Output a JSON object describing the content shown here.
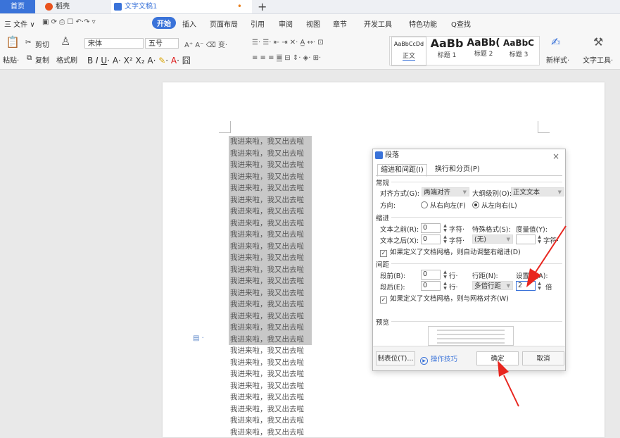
{
  "tabbar": {
    "home": "首页",
    "daoke": "稻壳",
    "doc": "文字文稿1",
    "modified_dot": "•",
    "plus": "+"
  },
  "menubar": {
    "file": "三 文件 ∨",
    "items": [
      "开始",
      "插入",
      "页面布局",
      "引用",
      "审阅",
      "视图",
      "章节",
      "开发工具",
      "特色功能"
    ],
    "search": "Q查找"
  },
  "ribbon": {
    "paste": "粘贴·",
    "cut": "剪切",
    "copy": "复制",
    "format_painter": "格式刷",
    "font_name": "宋体",
    "font_size": "五号",
    "styles": [
      {
        "sample": "AaBbCcDd",
        "name": "正文"
      },
      {
        "sample": "AaBb",
        "name": "标题 1"
      },
      {
        "sample": "AaBb(",
        "name": "标题 2"
      },
      {
        "sample": "AaBbC",
        "name": "标题 3"
      }
    ],
    "new_style": "新样式·",
    "text_tools": "文字工具·"
  },
  "document": {
    "line_text": "我进来啦，我又出去啦",
    "selected_count": 18,
    "unselected_count": 8
  },
  "dialog": {
    "title": "段落",
    "close": "×",
    "tabs": [
      "缩进和间距(I)",
      "换行和分页(P)"
    ],
    "sec_general": "常规",
    "align_label": "对齐方式(G):",
    "align_value": "两端对齐",
    "outline_label": "大纲级别(O):",
    "outline_value": "正文文本",
    "direction_label": "方向:",
    "dir_rtl": "从右向左(F)",
    "dir_ltr": "从左向右(L)",
    "sec_indent": "缩进",
    "before_text_label": "文本之前(R):",
    "before_text_value": "0",
    "after_text_label": "文本之后(X):",
    "after_text_value": "0",
    "unit_char": "字符·",
    "special_label": "特殊格式(S):",
    "special_value": "(无)",
    "measure_label": "度量值(Y):",
    "measure_unit": "字符·",
    "grid_indent": "如果定义了文档网格，则自动调整右缩进(D)",
    "sec_spacing": "间距",
    "before_label": "段前(B):",
    "before_value": "0",
    "after_label": "段后(E):",
    "after_value": "0",
    "unit_line": "行·",
    "line_spacing_label": "行距(N):",
    "line_spacing_value": "多倍行距",
    "set_value_label": "设置值(A):",
    "set_value": "2",
    "set_unit": "倍",
    "grid_align": "如果定义了文档网格，则与网格对齐(W)",
    "sec_preview": "预览",
    "tab_stops": "制表位(T)...",
    "tips": "操作技巧",
    "ok": "确定",
    "cancel": "取消"
  },
  "colors": {
    "accent": "#3a73d9",
    "arrow": "#e8261f",
    "selection": "#c8c8c8"
  }
}
